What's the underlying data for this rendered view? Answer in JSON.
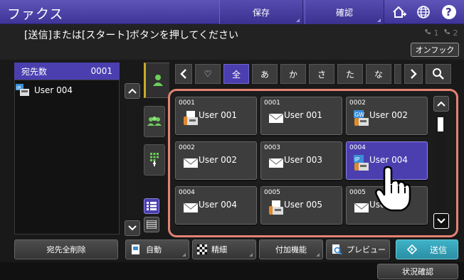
{
  "header": {
    "title": "ファクス",
    "save_label": "保存",
    "confirm_label": "確認",
    "home_icon": "home-plus-icon",
    "globe_icon": "globe-icon",
    "help_label": "?"
  },
  "message": {
    "text": "[送信]または[スタート]ボタンを押してください",
    "line1": "1",
    "line2": "2",
    "onhook_label": "オンフック"
  },
  "destinations": {
    "header_label": "宛先数",
    "count": "0001",
    "items": [
      {
        "name": "User 004",
        "icon": "ip-fax-icon"
      }
    ]
  },
  "tabs": {
    "favorite": "♡",
    "all": "全",
    "a": "あ",
    "ka": "か",
    "sa": "さ",
    "ta": "た",
    "na": "な"
  },
  "grid": [
    {
      "num": "0001",
      "name": "User 001",
      "type": "fax",
      "selected": false
    },
    {
      "num": "0001",
      "name": "User 001",
      "type": "email",
      "selected": false
    },
    {
      "num": "0002",
      "name": "User 002",
      "type": "gw-fax",
      "gw_label": "GW",
      "selected": false
    },
    {
      "num": "0002",
      "name": "User 002",
      "type": "email",
      "selected": false
    },
    {
      "num": "0003",
      "name": "User 003",
      "type": "email",
      "selected": false
    },
    {
      "num": "0004",
      "name": "User 004",
      "type": "ip-fax",
      "ip_label": "IP",
      "selected": true
    },
    {
      "num": "0004",
      "name": "User 004",
      "type": "email",
      "selected": false
    },
    {
      "num": "0005",
      "name": "User 005",
      "type": "fax",
      "selected": false
    },
    {
      "num": "0005",
      "name": "User 005",
      "type": "email",
      "selected": false
    }
  ],
  "bottom": {
    "clear_all": "宛先全削除",
    "auto": "自動",
    "fine": "精細",
    "extra": "付加機能",
    "preview": "プレビュー",
    "send": "送信",
    "status": "状況確認"
  },
  "colors": {
    "accent": "#4b3fb0",
    "highlight": "#e48374",
    "send": "#2a8ea4"
  }
}
